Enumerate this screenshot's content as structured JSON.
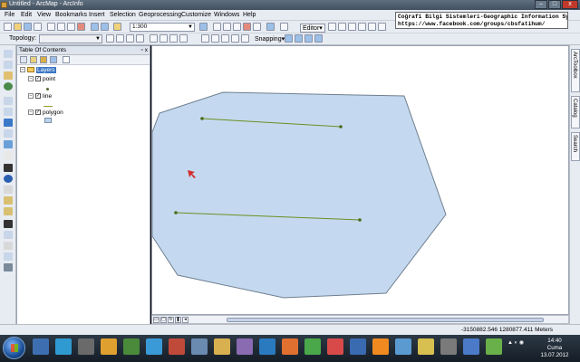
{
  "window": {
    "title": "Untitled - ArcMap - ArcInfo",
    "min": "–",
    "max": "□",
    "close": "x"
  },
  "menu": [
    "File",
    "Edit",
    "View",
    "Bookmarks",
    "Insert",
    "Selection",
    "Geoprocessing",
    "Customize",
    "Windows",
    "Help"
  ],
  "banner": {
    "line1": "Coğrafi Bilgi Sistemleri-Geographic Information System",
    "line2": "https://www.facebook.com/groups/cbsfatihum/"
  },
  "toolbar": {
    "scale": "1:300",
    "editor": "Editor▾",
    "topology": "Topology:",
    "snapping": "Snapping▾"
  },
  "toc": {
    "title": "Table Of Contents",
    "controls": "▫ x",
    "root": "Layers",
    "layers": [
      {
        "name": "point",
        "checked": "✓",
        "expand": "−",
        "symbol": "point"
      },
      {
        "name": "line",
        "checked": "✓",
        "expand": "−",
        "symbol": "line"
      },
      {
        "name": "polygon",
        "checked": "✓",
        "expand": "−",
        "symbol": "polygon"
      }
    ]
  },
  "map": {
    "polygon_fill": "#c4d9ef",
    "polygon_stroke": "#6f7f8f",
    "line_color": "#6b8e23",
    "vertex_color": "#4a6b1a",
    "cursor_color": "#d32f2f"
  },
  "right_dock": [
    "ArcToolbox",
    "Catalog",
    "Search"
  ],
  "status": {
    "coords": "-3150882.546  1280877.411 Meters"
  },
  "clock": {
    "time": "14:40",
    "day": "Cuma",
    "date": "13.07.2012"
  }
}
